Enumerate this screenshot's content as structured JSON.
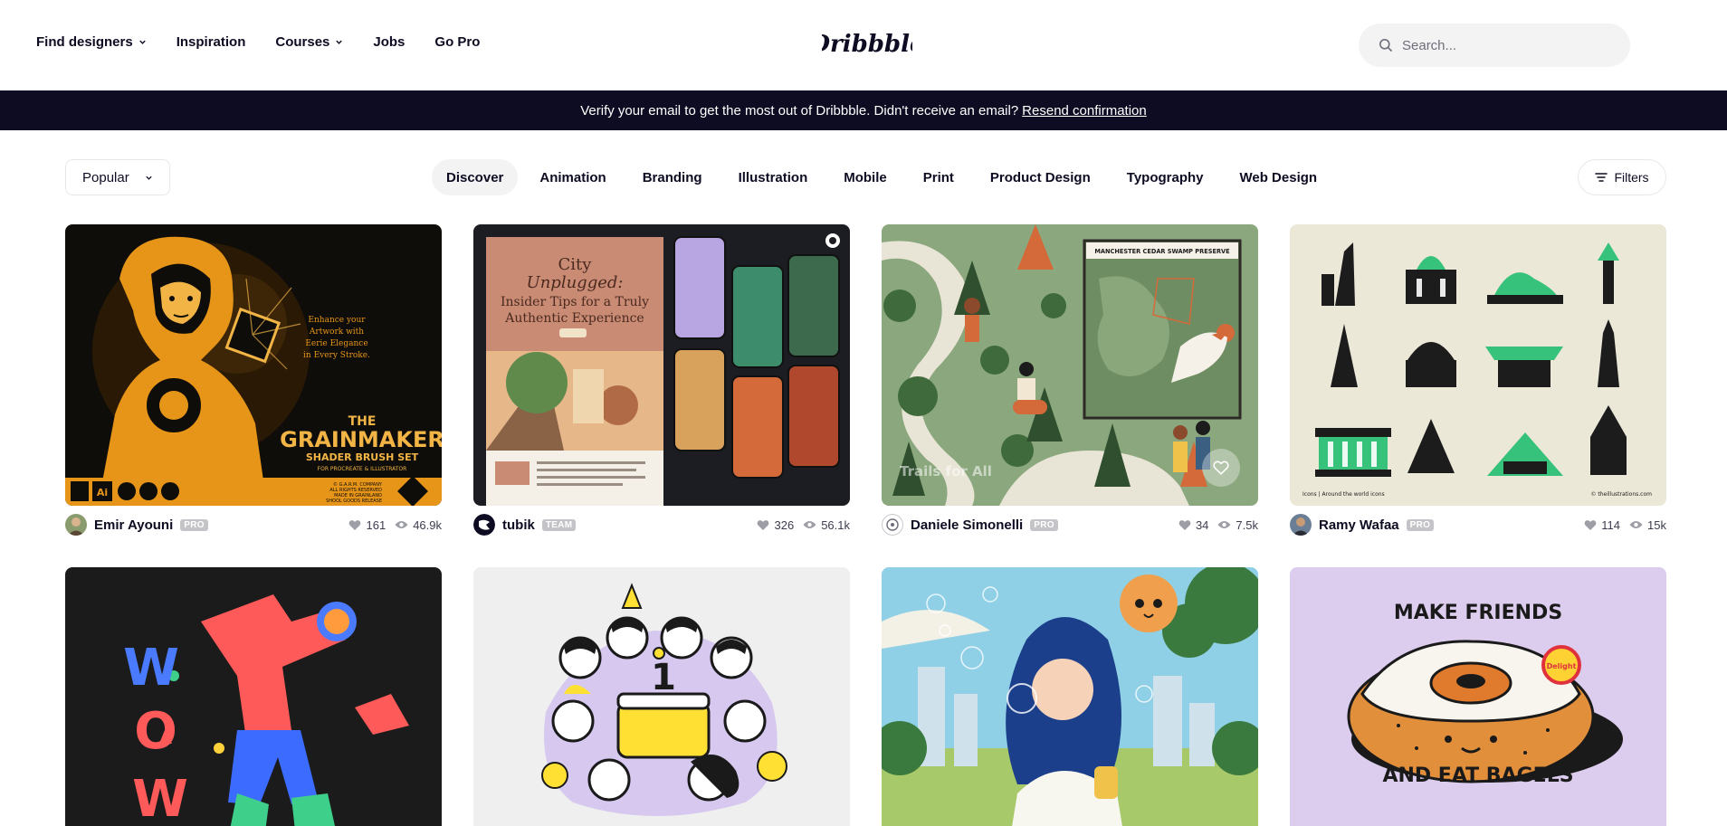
{
  "header": {
    "nav": [
      {
        "label": "Find designers",
        "dropdown": true
      },
      {
        "label": "Inspiration",
        "dropdown": false
      },
      {
        "label": "Courses",
        "dropdown": true
      },
      {
        "label": "Jobs",
        "dropdown": false
      },
      {
        "label": "Go Pro",
        "dropdown": false
      }
    ],
    "logo": "Dribbble",
    "search_placeholder": "Search..."
  },
  "banner": {
    "text": "Verify your email to get the most out of Dribbble. Didn't receive an email?",
    "link": "Resend confirmation"
  },
  "filters": {
    "sort": "Popular",
    "categories": [
      "Discover",
      "Animation",
      "Branding",
      "Illustration",
      "Mobile",
      "Print",
      "Product Design",
      "Typography",
      "Web Design"
    ],
    "active_category": "Discover",
    "filters_label": "Filters"
  },
  "shots": [
    {
      "author": "Emir Ayouni",
      "badge": "PRO",
      "likes": "161",
      "views": "46.9k",
      "art": {
        "line1": "THE",
        "line2": "GRAINMAKER",
        "line3": "SHADER BRUSH SET",
        "line4": "FOR PROCREATE & ILLUSTRATOR",
        "tag": "Enhance your Artwork with Eerie Elegance in Every Stroke.",
        "icon": "Ai",
        "footer1": "© G.A.R.M. COMPANY",
        "footer2": "ALL RIGHTS RESERVED",
        "footer3": "MADE IN GRAINLAND",
        "footer4": "SHOOL GOODS RELEASE"
      }
    },
    {
      "author": "tubik",
      "badge": "TEAM",
      "likes": "326",
      "views": "56.1k",
      "art": {
        "title1": "City",
        "title2": "Unplugged:",
        "title3": "Insider Tips for a Truly",
        "title4": "Authentic Experience"
      }
    },
    {
      "author": "Daniele Simonelli",
      "badge": "PRO",
      "likes": "34",
      "views": "7.5k",
      "art": {
        "sign": "MANCHESTER CEDAR SWAMP PRESERVE",
        "overlay": "Trails for All"
      }
    },
    {
      "author": "Ramy Wafaa",
      "badge": "PRO",
      "likes": "114",
      "views": "15k",
      "art": {
        "caption": "Icons | Around the world icons",
        "credit": "© theillustrations.com"
      }
    },
    {
      "author": "",
      "badge": "",
      "likes": "",
      "views": "",
      "art": {
        "letters": [
          "W",
          "O",
          "W"
        ]
      }
    },
    {
      "author": "",
      "badge": "",
      "likes": "",
      "views": "",
      "art": {
        "number": "1"
      }
    },
    {
      "author": "",
      "badge": "",
      "likes": "",
      "views": "",
      "art": {}
    },
    {
      "author": "",
      "badge": "",
      "likes": "",
      "views": "",
      "art": {
        "top": "MAKE FRIENDS",
        "bottom": "AND EAT BAGELS",
        "stamp": "Delight"
      }
    }
  ],
  "colors": {
    "accent": "#ea4c89",
    "ink": "#0d0c22",
    "banner": "#0d0c22",
    "chip": "#f3f3f4",
    "badge": "#c4c3c8"
  },
  "icons": [
    "chevron-down-icon",
    "search-icon",
    "filters-icon",
    "heart-icon",
    "eye-icon"
  ]
}
